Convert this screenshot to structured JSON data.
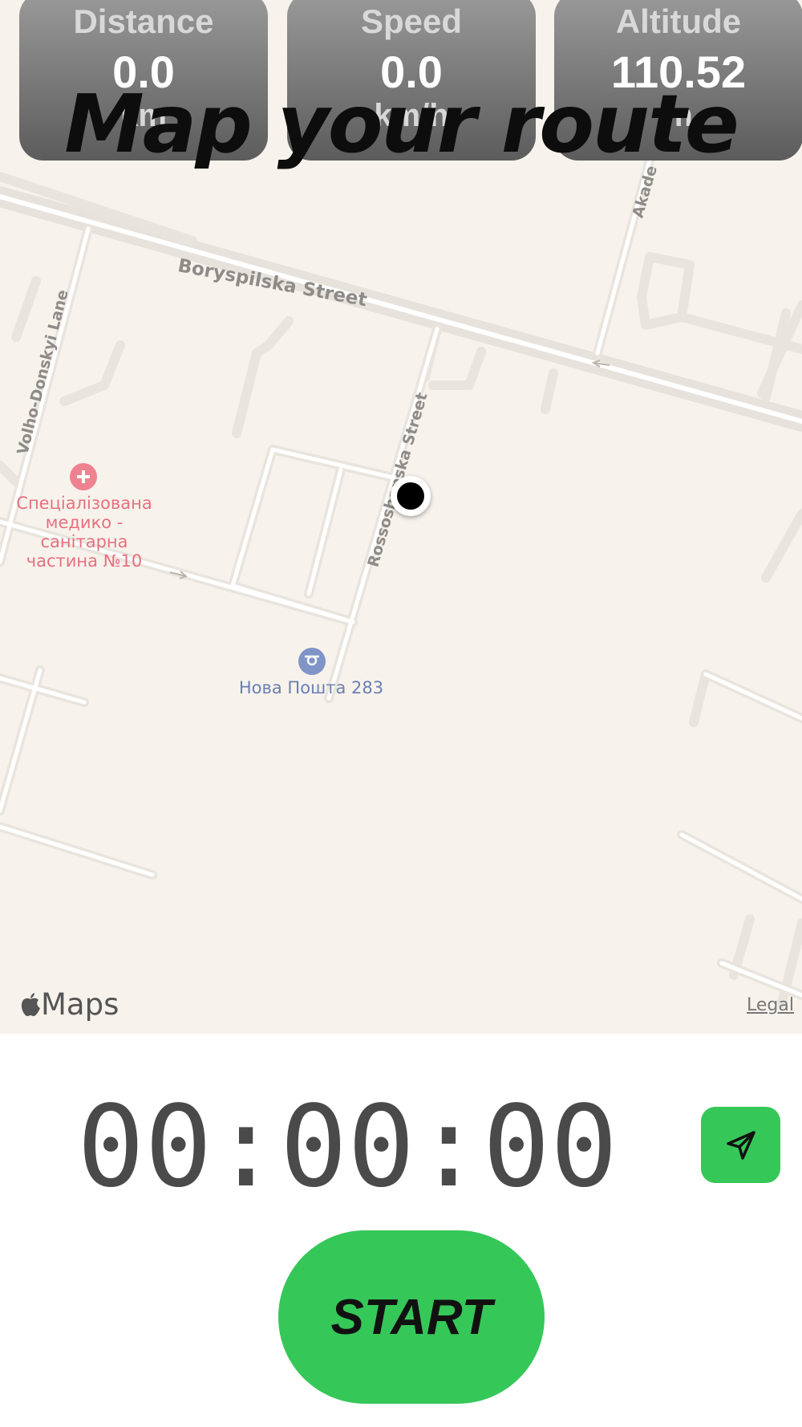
{
  "stats": [
    {
      "label": "Distance",
      "value": "0.0",
      "unit": "km"
    },
    {
      "label": "Speed",
      "value": "0.0",
      "unit": "km/h"
    },
    {
      "label": "Altitude",
      "value": "110.52",
      "unit": "m"
    }
  ],
  "headline": "Map your route",
  "map": {
    "streets": {
      "boryspilska": "Boryspilska Street",
      "volho": "Volho-Donskyi Lane",
      "rossoshanska": "Rossoshanska Street",
      "akade": "Akade"
    },
    "poi_medical": {
      "label_line1": "Спеціалізована",
      "label_line2": "медико -",
      "label_line3": "санітарна",
      "label_line4": "частина №10",
      "color": "#e8707f",
      "icon": "medical-cross-icon"
    },
    "poi_post": {
      "label": "Нова Пошта 283",
      "color": "#6b7fb3",
      "icon": "post-horn-icon"
    },
    "attribution": "Maps",
    "legal": "Legal"
  },
  "timer": {
    "display": "00:00:00"
  },
  "share": {
    "icon": "navigation-arrow-icon",
    "color": "#36c759"
  },
  "start": {
    "label": "START",
    "color": "#36c759"
  }
}
